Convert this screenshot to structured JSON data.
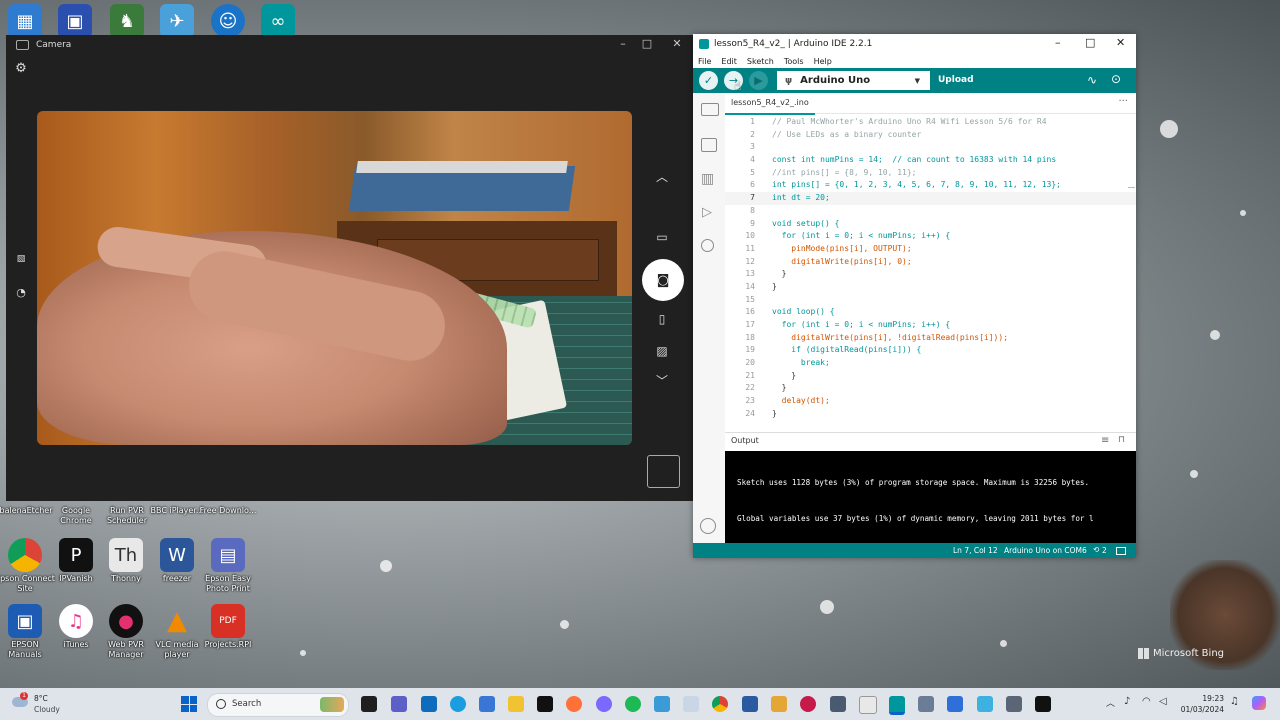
{
  "desktop": {
    "icons_top_row_labels": [
      "balenaEtcher",
      "Google Chrome",
      "Run PVR Scheduler",
      "BBC iPlayer...",
      "Free Downlo..."
    ],
    "icons_row2": [
      "Epson Connect Site",
      "IPVanish",
      "Thonny",
      "freezer",
      "Epson Easy Photo Print"
    ],
    "icons_row3": [
      "EPSON Manuals",
      "iTunes",
      "Web PVR Manager",
      "VLC media player",
      "Projects.RPI"
    ],
    "watermark": "Microsoft Bing"
  },
  "camera": {
    "title": "Camera"
  },
  "ide": {
    "title": "lesson5_R4_v2_ | Arduino IDE 2.2.1",
    "menu": [
      "File",
      "Edit",
      "Sketch",
      "Tools",
      "Help"
    ],
    "board": "Arduino Uno",
    "upload_label": "Upload",
    "tab": "lesson5_R4_v2_.ino",
    "code": [
      {
        "n": "1",
        "t": "// Paul McWhorter's Arduino Uno R4 Wifi Lesson 5/6 for R4"
      },
      {
        "n": "2",
        "t": "// Use LEDs as a binary counter"
      },
      {
        "n": "3",
        "t": ""
      },
      {
        "n": "4",
        "t": "const int numPins = 14;  // can count to 16383 with 14 pins"
      },
      {
        "n": "5",
        "t": "//int pins[] = {8, 9, 10, 11};"
      },
      {
        "n": "6",
        "t": "int pins[] = {0, 1, 2, 3, 4, 5, 6, 7, 8, 9, 10, 11, 12, 13};"
      },
      {
        "n": "7",
        "t": "int dt = 20;"
      },
      {
        "n": "8",
        "t": ""
      },
      {
        "n": "9",
        "t": "void setup() {"
      },
      {
        "n": "10",
        "t": "  for (int i = 0; i < numPins; i++) {"
      },
      {
        "n": "11",
        "t": "    pinMode(pins[i], OUTPUT);"
      },
      {
        "n": "12",
        "t": "    digitalWrite(pins[i], 0);"
      },
      {
        "n": "13",
        "t": "  }"
      },
      {
        "n": "14",
        "t": "}"
      },
      {
        "n": "15",
        "t": ""
      },
      {
        "n": "16",
        "t": "void loop() {"
      },
      {
        "n": "17",
        "t": "  for (int i = 0; i < numPins; i++) {"
      },
      {
        "n": "18",
        "t": "    digitalWrite(pins[i], !digitalRead(pins[i]));"
      },
      {
        "n": "19",
        "t": "    if (digitalRead(pins[i])) {"
      },
      {
        "n": "20",
        "t": "      break;"
      },
      {
        "n": "21",
        "t": "    }"
      },
      {
        "n": "22",
        "t": "  }"
      },
      {
        "n": "23",
        "t": "  delay(dt);"
      },
      {
        "n": "24",
        "t": "}"
      }
    ],
    "output_title": "Output",
    "output_lines": [
      "Sketch uses 1128 bytes (3%) of program storage space. Maximum is 32256 bytes.",
      "Global variables use 37 bytes (1%) of dynamic memory, leaving 2011 bytes for l"
    ],
    "status": {
      "cursor": "Ln 7, Col 12",
      "board_port": "Arduino Uno on COM6",
      "notifications": "2"
    }
  },
  "taskbar": {
    "weather_temp": "8°C",
    "weather_desc": "Cloudy",
    "search_placeholder": "Search",
    "time": "19:23",
    "date": "01/03/2024"
  }
}
